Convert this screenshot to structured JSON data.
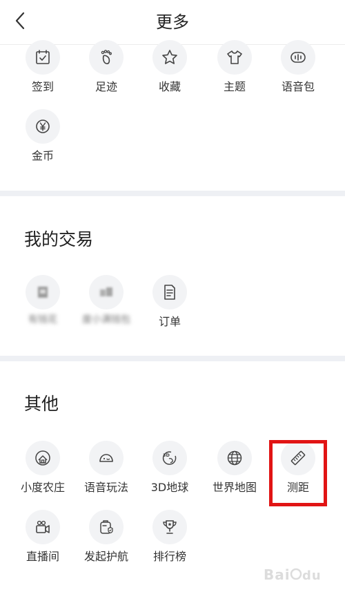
{
  "header": {
    "title": "更多"
  },
  "top_grid": [
    {
      "label": "签到",
      "icon": "calendar-check-icon"
    },
    {
      "label": "足迹",
      "icon": "footprint-icon"
    },
    {
      "label": "收藏",
      "icon": "star-icon"
    },
    {
      "label": "主题",
      "icon": "tshirt-icon"
    },
    {
      "label": "语音包",
      "icon": "voice-wave-icon"
    },
    {
      "label": "金币",
      "icon": "yen-coin-icon"
    }
  ],
  "trade": {
    "title": "我的交易",
    "items": [
      {
        "label": "有钱花",
        "icon": "blurred-app-icon"
      },
      {
        "label": "度小满钱包",
        "icon": "blurred-app-icon"
      },
      {
        "label": "订单",
        "icon": "document-icon"
      }
    ]
  },
  "other": {
    "title": "其他",
    "items": [
      {
        "label": "小度农庄",
        "icon": "farm-house-icon"
      },
      {
        "label": "语音玩法",
        "icon": "voice-toy-icon"
      },
      {
        "label": "3D地球",
        "icon": "3d-globe-icon"
      },
      {
        "label": "世界地图",
        "icon": "world-globe-icon"
      },
      {
        "label": "测距",
        "icon": "ruler-icon"
      },
      {
        "label": "直播间",
        "icon": "live-camera-icon"
      },
      {
        "label": "发起护航",
        "icon": "shield-escort-icon"
      },
      {
        "label": "排行榜",
        "icon": "trophy-icon"
      }
    ]
  },
  "colors": {
    "highlight": "#e11414",
    "icon_bg": "#f2f3f5",
    "divider": "#eef0f4"
  }
}
